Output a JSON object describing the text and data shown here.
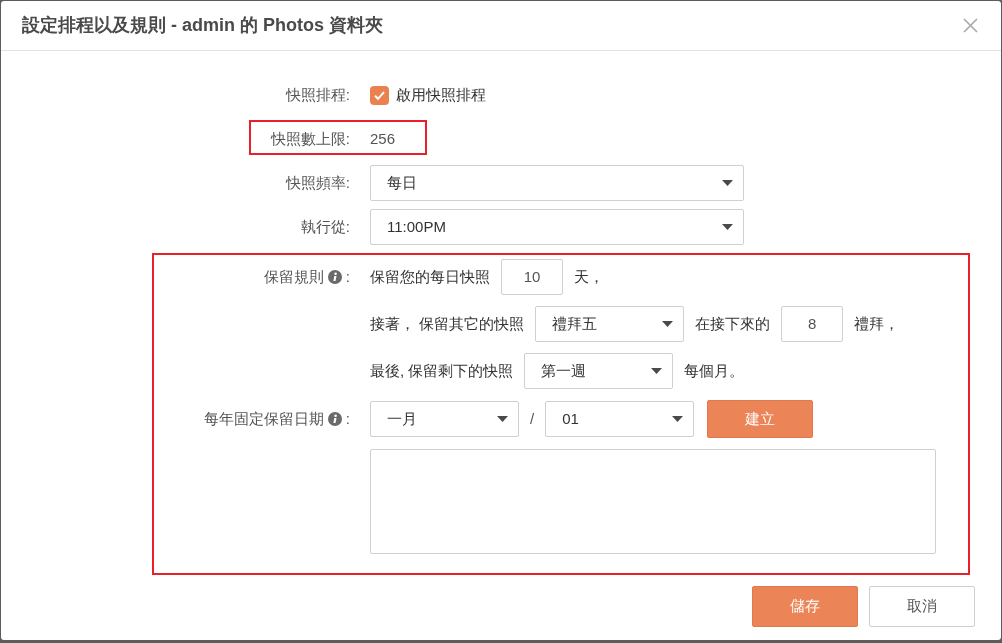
{
  "dialog": {
    "title": "設定排程以及規則 - admin 的 Photos 資料夾"
  },
  "schedule": {
    "label": "快照排程:",
    "checkbox": {
      "label": "啟用快照排程",
      "checked": true
    }
  },
  "snapshot_limit": {
    "label": "快照數上限:",
    "value": "256",
    "highlighted": true
  },
  "frequency": {
    "label": "快照頻率:",
    "value": "每日"
  },
  "start_time": {
    "label": "執行從:",
    "value": "11:00PM"
  },
  "retention": {
    "highlighted": true,
    "label": "保留規則",
    "colon": ":",
    "rows": [
      {
        "parts": [
          {
            "kind": "text",
            "text": "保留您的每日快照"
          },
          {
            "kind": "input",
            "value": "10"
          },
          {
            "kind": "text",
            "text": "天，"
          }
        ]
      },
      {
        "parts": [
          {
            "kind": "text",
            "text": "接著， 保留其它的快照"
          },
          {
            "kind": "select",
            "value": "禮拜五"
          },
          {
            "kind": "text",
            "text": "在接下來的"
          },
          {
            "kind": "input",
            "value": "8"
          },
          {
            "kind": "text",
            "text": "禮拜，"
          }
        ]
      },
      {
        "parts": [
          {
            "kind": "text",
            "text": "最後, 保留剩下的快照"
          },
          {
            "kind": "select",
            "value": "第一週"
          },
          {
            "kind": "text",
            "text": "每個月。"
          }
        ]
      }
    ],
    "annual_dates": {
      "label": "每年固定保留日期",
      "colon": ":",
      "month": "一月",
      "separator": "/",
      "day": "01",
      "create_button": "建立"
    }
  },
  "buttons": [
    {
      "label": "儲存",
      "kind": "primary"
    },
    {
      "label": "取消",
      "kind": "secondary"
    }
  ]
}
